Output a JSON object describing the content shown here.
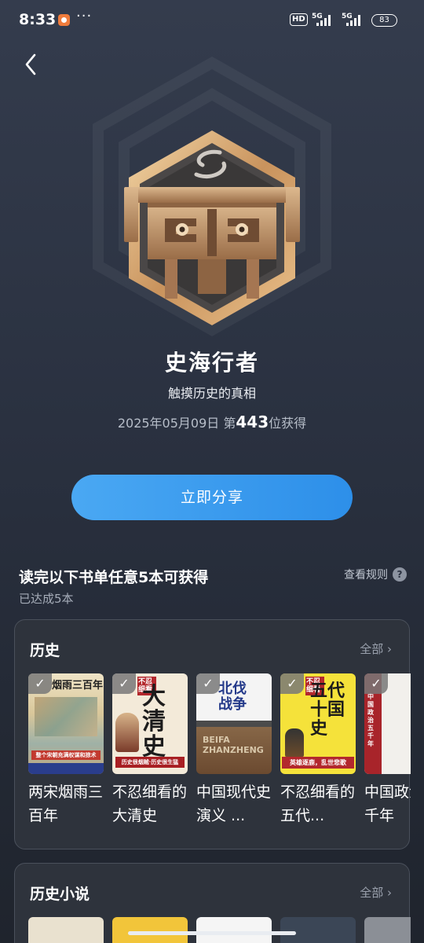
{
  "status_bar": {
    "time": "8:33",
    "dots": "···",
    "hd": "HD",
    "net1": "5G",
    "net2": "5G",
    "battery": "83"
  },
  "badge": {
    "title": "史海行者",
    "subtitle": "触摸历史的真相",
    "date": "2025年05月09日",
    "rank_prefix": "第",
    "rank": "443",
    "rank_suffix": "位获得"
  },
  "share_button_label": "立即分享",
  "requirement": {
    "title": "读完以下书单任意5本可获得",
    "progress": "已达成5本",
    "rules_label": "查看规则",
    "rules_icon": "?"
  },
  "sections": [
    {
      "title": "历史",
      "all_label": "全部 ›",
      "books": [
        {
          "name": "两宋烟雨三百年",
          "checked": true,
          "cover_title": "烟雨三百年",
          "cover_sub": "整个宋朝充满权谋和掠术"
        },
        {
          "name": "不忍细看的大清史",
          "checked": true,
          "cover_tag": "不忍细看",
          "cover_title": "大清史",
          "cover_sub": "历史很烟贼·历史很生猛"
        },
        {
          "name": "中国现代史演义 ...",
          "checked": true,
          "cover_title": "北伐战争",
          "cover_sub": "BEIFA ZHANZHENG"
        },
        {
          "name": "不忍细看的五代...",
          "checked": true,
          "cover_tag": "不忍细看",
          "cover_title": "五代十国史",
          "cover_sub": "英雄逐鹿，乱世悲歌"
        },
        {
          "name": "中国政治五千年",
          "checked": true,
          "cover_title": "中国政治五千年"
        }
      ]
    },
    {
      "title": "历史小说",
      "all_label": "全部 ›"
    }
  ],
  "colors": {
    "accent": "#3a9af0",
    "card_bg": "#2e333c",
    "page_bg": "#2a3140"
  }
}
